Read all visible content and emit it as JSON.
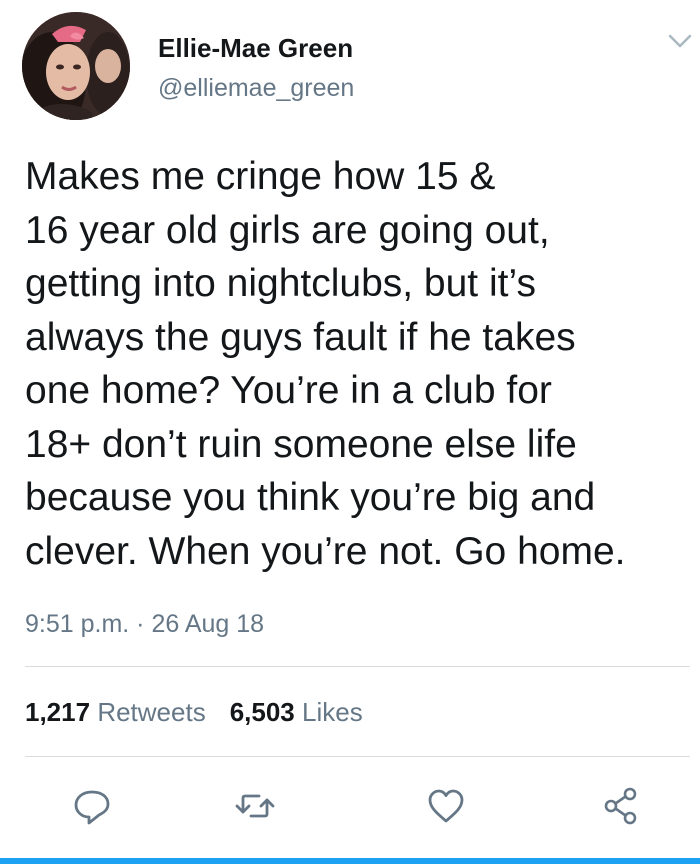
{
  "user": {
    "display_name": "Ellie-Mae Green",
    "handle": "@elliemae_green"
  },
  "tweet": {
    "lines": [
      "Makes me cringe how 15 &",
      "16 year old girls are going out,",
      "getting into nightclubs, but it’s",
      "always the guys fault if he takes",
      "one home? You’re in a club for",
      "18+ don’t ruin someone else life",
      "because you think you’re big and",
      "clever. When you’re not. Go home."
    ],
    "time": "9:51 p.m.",
    "separator": " · ",
    "date": "26 Aug 18"
  },
  "stats": {
    "retweets_count": "1,217",
    "retweets_label": "Retweets",
    "likes_count": "6,503",
    "likes_label": "Likes"
  },
  "icons": {
    "menu": "chevron-down-icon",
    "reply": "reply-icon",
    "retweet": "retweet-icon",
    "like": "heart-icon",
    "share": "share-icon"
  },
  "colors": {
    "text": "#14171a",
    "secondary": "#657786",
    "icon": "#657786",
    "divider": "#d9dde0",
    "accent": "#1da1f2"
  }
}
